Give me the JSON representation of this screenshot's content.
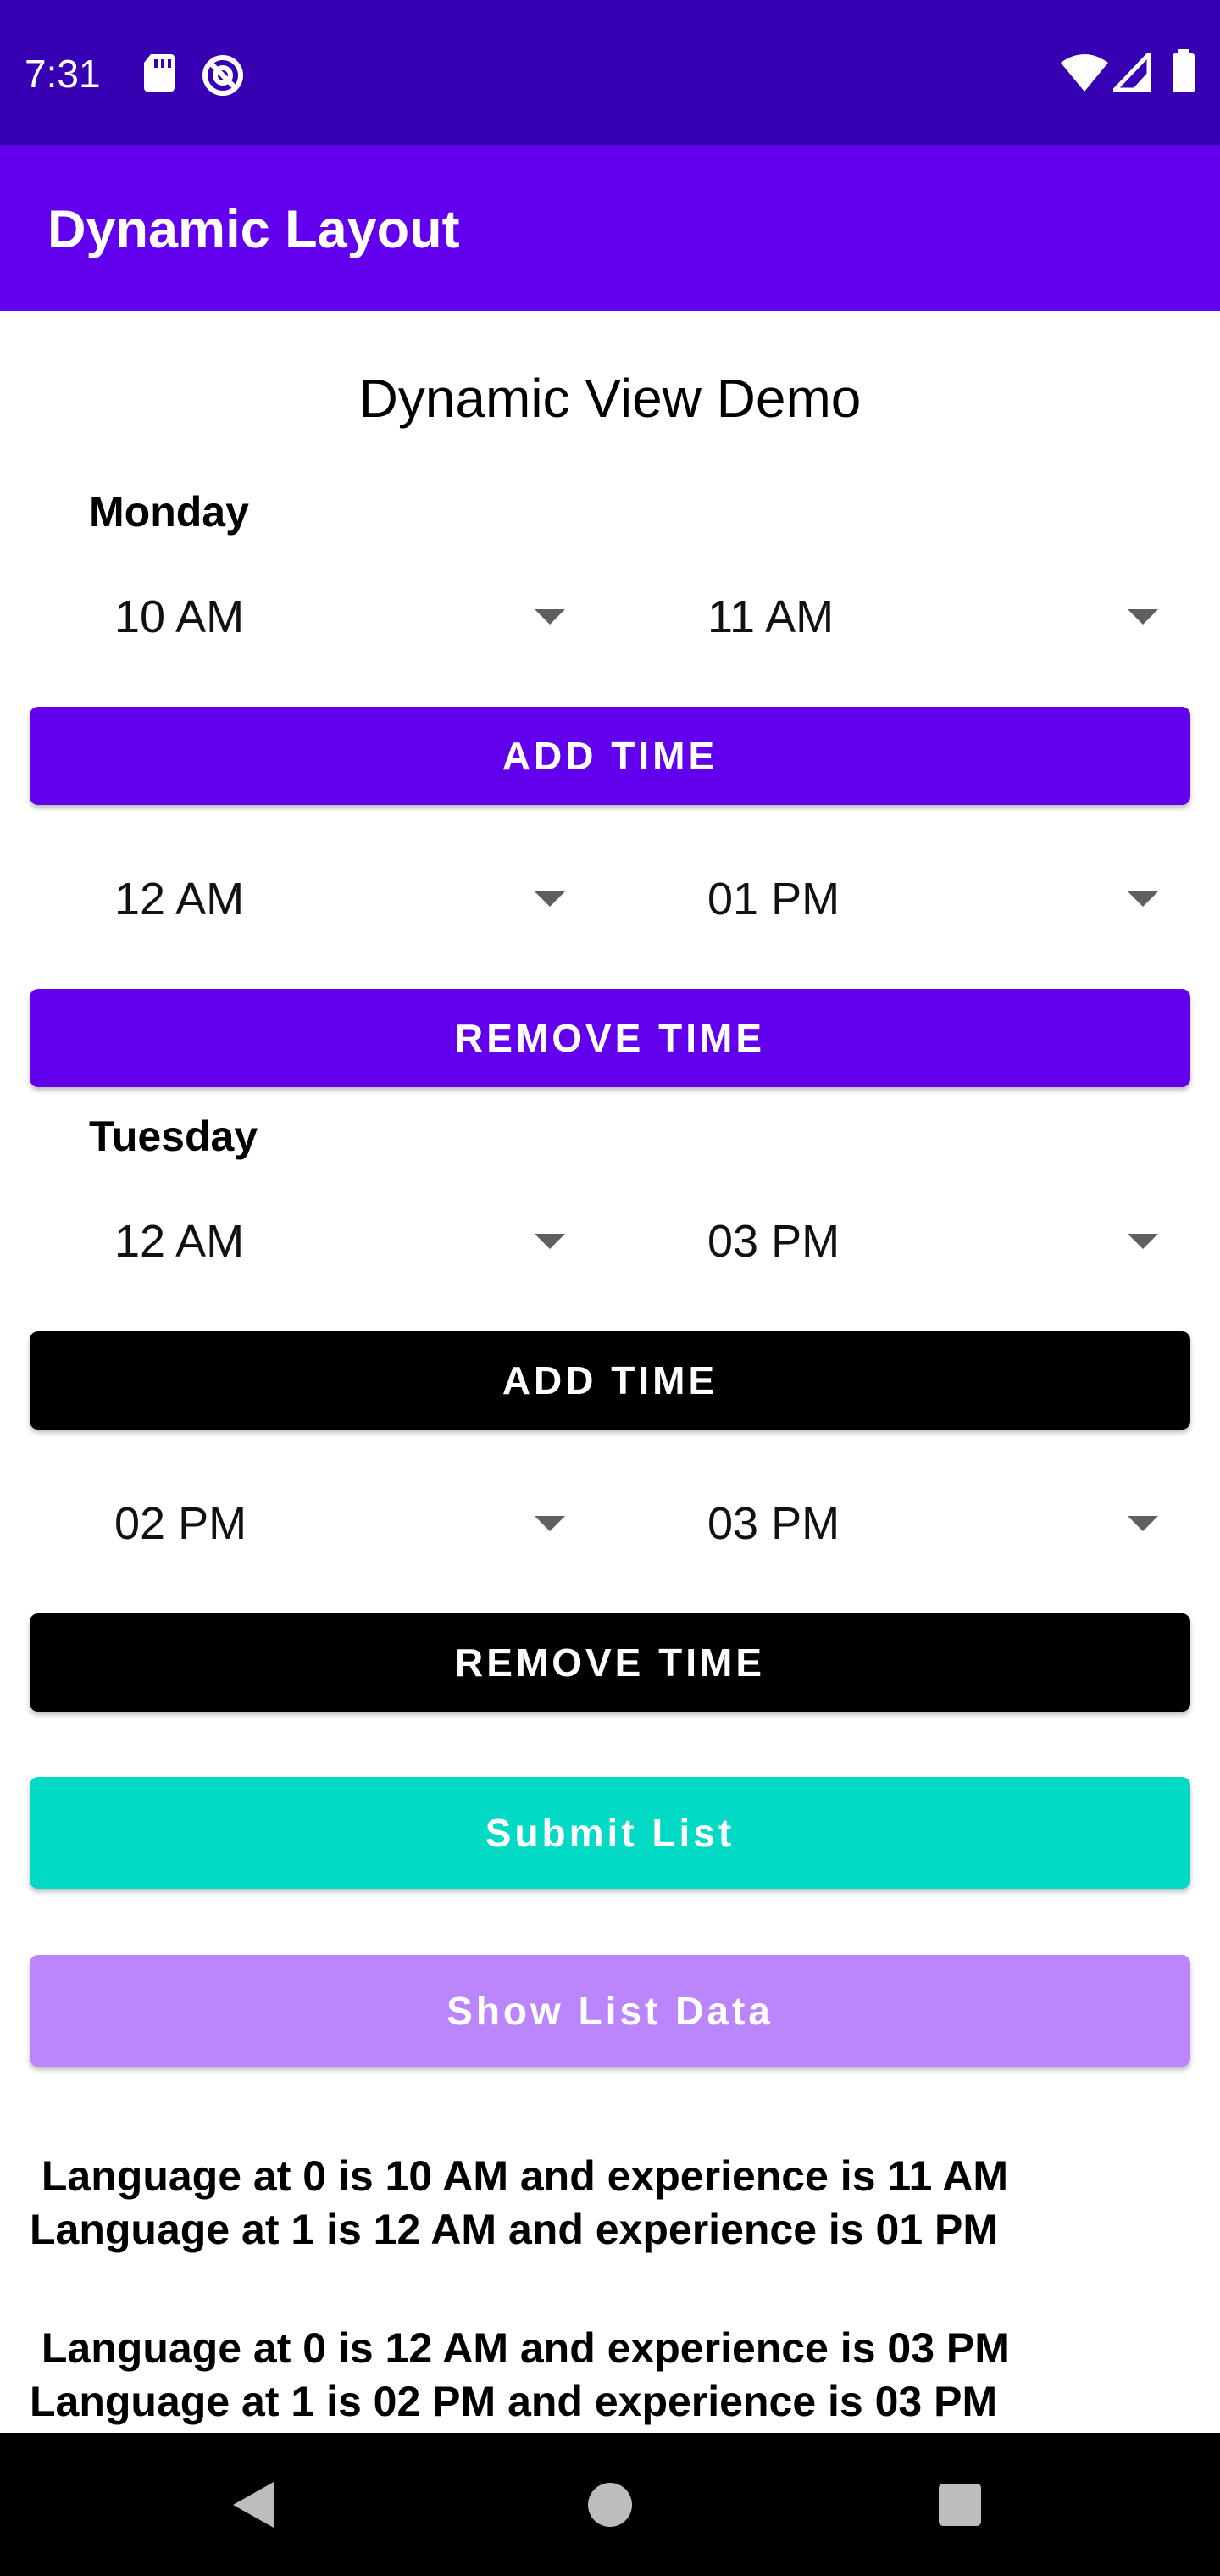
{
  "status_bar": {
    "time": "7:31",
    "icons": [
      "sd-card-icon",
      "sync-icon",
      "wifi-icon",
      "signal-icon",
      "battery-icon"
    ]
  },
  "app_bar": {
    "title": "Dynamic Layout"
  },
  "page_title": "Dynamic View Demo",
  "days": [
    {
      "label": "Monday",
      "rows": [
        {
          "from": "10 AM",
          "to": "11 AM",
          "button": "ADD TIME"
        },
        {
          "from": "12 AM",
          "to": "01 PM",
          "button": "REMOVE TIME"
        }
      ]
    },
    {
      "label": "Tuesday",
      "rows": [
        {
          "from": "12 AM",
          "to": "03 PM",
          "button": "ADD TIME"
        },
        {
          "from": "02 PM",
          "to": "03 PM",
          "button": "REMOVE TIME"
        }
      ]
    }
  ],
  "actions": {
    "submit": "Submit List",
    "show": "Show List Data"
  },
  "results": [
    [
      " Language at 0 is 10 AM and experience is 11 AM",
      "Language at 1 is 12 AM and experience is 01 PM"
    ],
    [
      " Language at 0 is 12 AM and experience is 03 PM",
      "Language at 1 is 02 PM and experience is 03 PM"
    ]
  ],
  "colors": {
    "status_bar": "#3700b3",
    "app_bar": "#6200ee",
    "monday_buttons": "#6200ee",
    "tuesday_buttons": "#000000",
    "submit": "#03dac5",
    "show": "#bb86fc"
  }
}
